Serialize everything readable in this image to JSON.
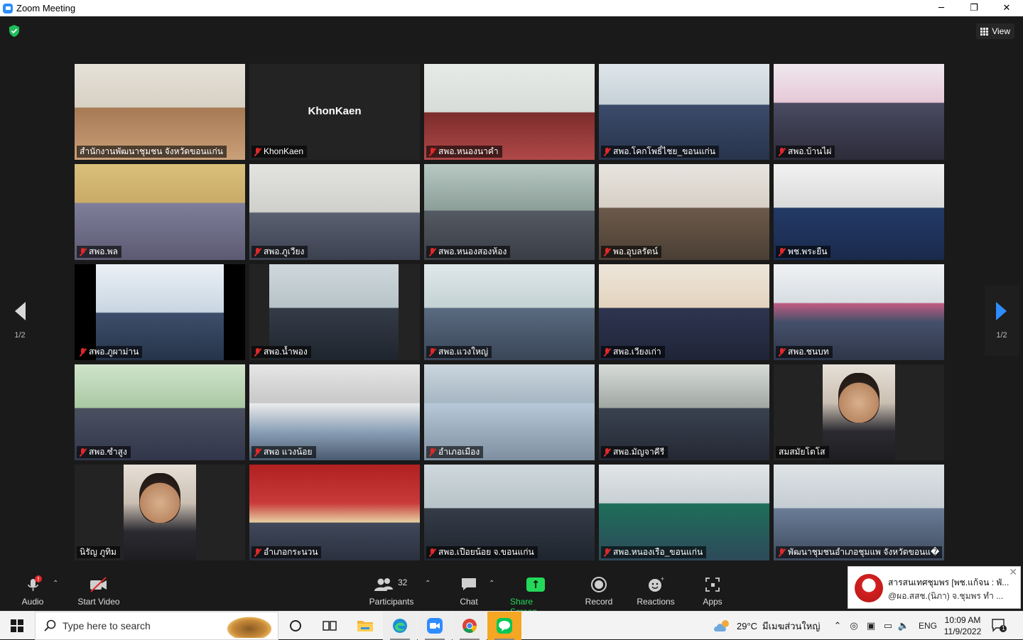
{
  "window": {
    "title": "Zoom Meeting",
    "minimize": "─",
    "restore": "❐",
    "close": "✕"
  },
  "meeting": {
    "view_label": "View",
    "page_indicator_left": "1/2",
    "page_indicator_right": "1/2",
    "tiles": [
      {
        "label": "สำนักงานพัฒนาชุมชน จังหวัดขอนแก่น",
        "muted": false,
        "active": true
      },
      {
        "label": "KhonKaen",
        "muted": true,
        "name_only": "KhonKaen"
      },
      {
        "label": "สพอ.หนองนาคำ",
        "muted": true
      },
      {
        "label": "สพอ.โคกโพธิ์ไชย_ขอนแก่น",
        "muted": true
      },
      {
        "label": "สพอ.บ้านไผ่",
        "muted": true
      },
      {
        "label": "สพอ.พล",
        "muted": true
      },
      {
        "label": "สพอ.ภูเวียง",
        "muted": true
      },
      {
        "label": "สพอ.หนองสองห้อง",
        "muted": true
      },
      {
        "label": "พอ.อุบลรัตน์",
        "muted": true
      },
      {
        "label": "พช.พระยืน",
        "muted": true
      },
      {
        "label": "สพอ.ภูผาม่าน",
        "muted": true
      },
      {
        "label": "สพอ.น้ำพอง",
        "muted": true
      },
      {
        "label": "สพอ.แวงใหญ่",
        "muted": true
      },
      {
        "label": "สพอ.เวียงเก่า",
        "muted": true
      },
      {
        "label": "สพอ.ชนบท",
        "muted": true
      },
      {
        "label": "สพอ.ซำสูง",
        "muted": true
      },
      {
        "label": "สพอ แวงน้อย",
        "muted": true
      },
      {
        "label": "อำเภอเมือง",
        "muted": true
      },
      {
        "label": "สพอ.มัญจาคีรี",
        "muted": true
      },
      {
        "label": "สมสมัยโตโส",
        "muted": false
      },
      {
        "label": "นิรัญ ภูทิม",
        "muted": false
      },
      {
        "label": "อำเภอกระนวน",
        "muted": true
      },
      {
        "label": "สพอ.เปือยน้อย จ.ขอนแก่น",
        "muted": true
      },
      {
        "label": "สพอ.หนองเรือ_ขอนแก่น",
        "muted": true
      },
      {
        "label": "พัฒนาชุมชนอำเภอชุมแพ จังหวัดขอนแ�",
        "muted": true
      }
    ]
  },
  "toolbar": {
    "audio": "Audio",
    "start_video": "Start Video",
    "participants": "Participants",
    "participants_count": "32",
    "chat": "Chat",
    "share_screen": "Share Screen",
    "record": "Record",
    "reactions": "Reactions",
    "apps": "Apps"
  },
  "toast": {
    "line1": "สารสนเทศชุมพร [พช.แก้จน : พั...",
    "line2": "@ผอ.สสช.(นิภา) จ.ชุมพร ทำ ..."
  },
  "taskbar": {
    "search_placeholder": "Type here to search",
    "weather_temp": "29°C",
    "weather_desc": "มีเมฆส่วนใหญ่",
    "lang": "ENG",
    "time": "10:09 AM",
    "date": "11/9/2022",
    "notif_count": "1"
  },
  "colors": {
    "zoom_blue": "#2d8cff",
    "share_green": "#23d959",
    "active_speaker": "#e4f06a",
    "muted_red": "#e02828"
  }
}
